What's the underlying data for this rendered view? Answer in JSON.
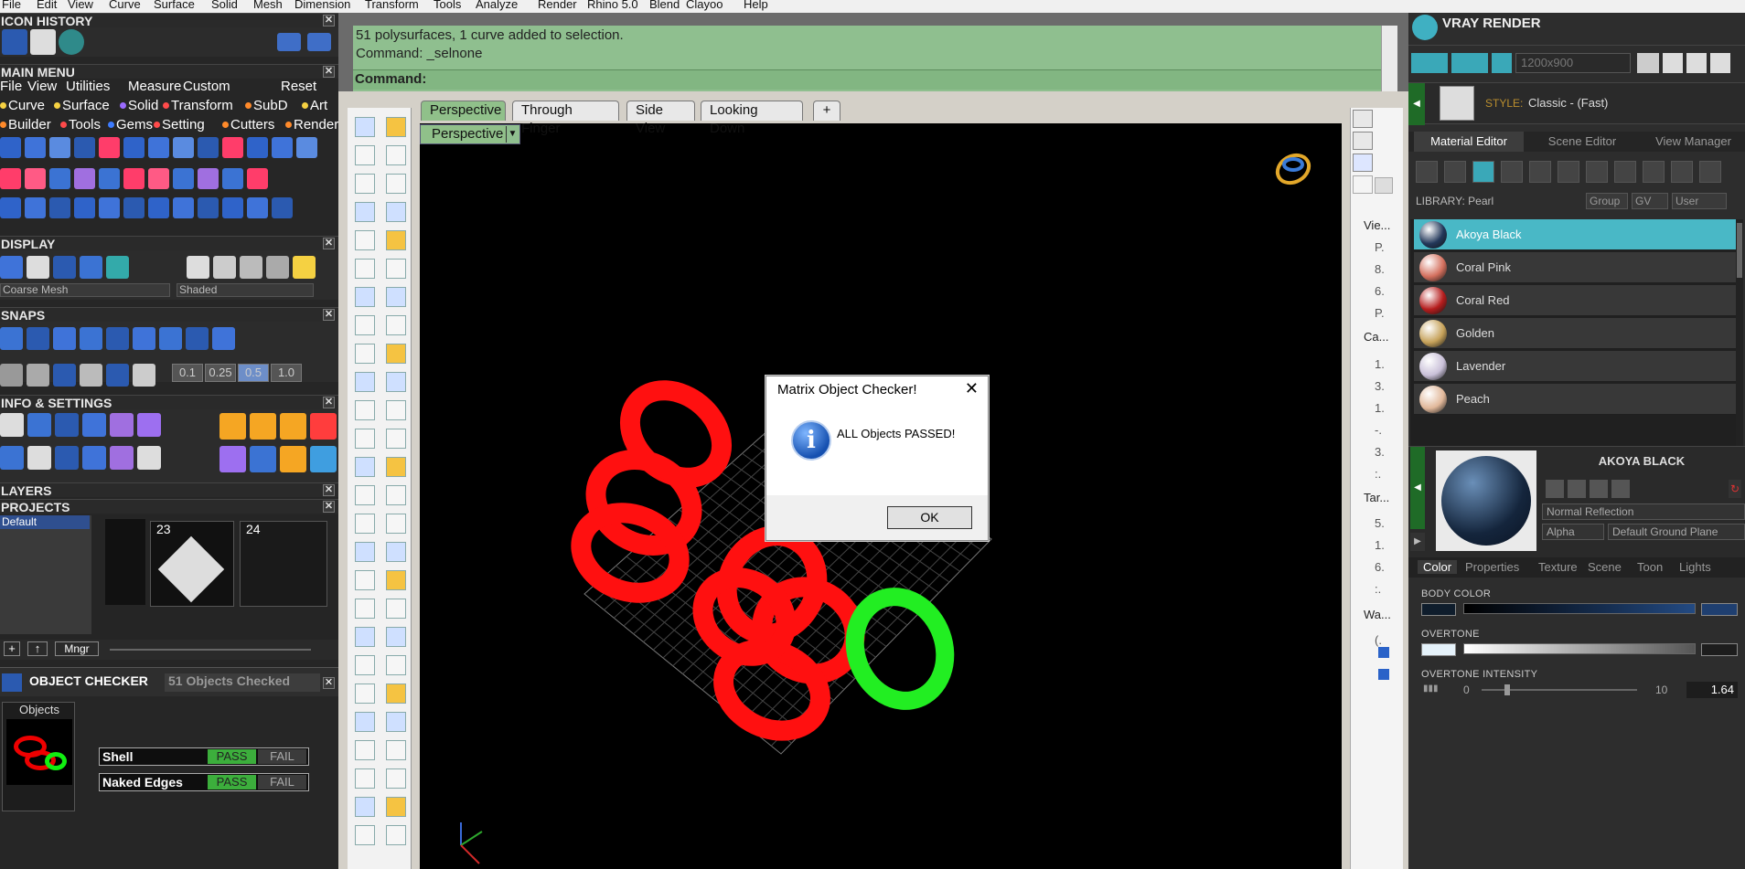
{
  "menubar": [
    "File",
    "Edit",
    "View",
    "Curve",
    "Surface",
    "Solid",
    "Mesh",
    "Dimension",
    "Transform",
    "Tools",
    "Analyze",
    "Render",
    "Rhino 5.0",
    "Blend",
    "Clayoo",
    "Help"
  ],
  "left": {
    "icon_history": "ICON HISTORY",
    "main_menu": "MAIN MENU",
    "mm_row1": [
      "File",
      "View",
      "Utilities",
      "Measure",
      "Custom"
    ],
    "mm_reset": "Reset",
    "mm_row2": [
      {
        "label": "Curve",
        "color": "#f5d142"
      },
      {
        "label": "Surface",
        "color": "#f5d142"
      },
      {
        "label": "Solid",
        "color": "#9b6bff"
      },
      {
        "label": "Transform",
        "color": "#ff4a4a"
      },
      {
        "label": "SubD",
        "color": "#ff8a2a"
      },
      {
        "label": "Art",
        "color": "#f5d142"
      }
    ],
    "mm_row3": [
      {
        "label": "Builder",
        "color": "#ff8a2a"
      },
      {
        "label": "Tools",
        "color": "#ff4a4a"
      },
      {
        "label": "Gems",
        "color": "#3d7cff"
      },
      {
        "label": "Setting",
        "color": "#ff4a4a"
      },
      {
        "label": "Cutters",
        "color": "#ff8a2a"
      },
      {
        "label": "Render",
        "color": "#ff8a2a"
      }
    ],
    "display": "DISPLAY",
    "display_mesh": "Coarse Mesh",
    "display_mode": "Shaded",
    "snaps": "SNAPS",
    "snap_values": [
      "0.1",
      "0.25",
      "0.5",
      "1.0"
    ],
    "info_settings": "INFO & SETTINGS",
    "layers": "LAYERS",
    "projects": "PROJECTS",
    "project_default": "Default",
    "project_nums": [
      "23",
      "24"
    ],
    "mngr": "Mngr",
    "object_checker": "OBJECT CHECKER",
    "checker_status": "51  Objects Checked",
    "objects_label": "Objects",
    "checks": [
      {
        "name": "Shell",
        "pass": "PASS",
        "fail": "FAIL"
      },
      {
        "name": "Naked Edges",
        "pass": "PASS",
        "fail": "FAIL"
      }
    ]
  },
  "command": {
    "line1": "51 polysurfaces, 1 curve added to selection.",
    "line2": "Command: _selnone",
    "prompt": "Command:"
  },
  "tabs": [
    "Perspective",
    "Through Finger",
    "Side View",
    "Looking Down"
  ],
  "viewport_label": "Perspective",
  "right_strip": [
    "Vie...",
    "P.",
    "8.",
    "6.",
    "P.",
    "Ca...",
    "1.",
    "3.",
    "1.",
    "-.",
    "3.",
    ":.",
    "Tar...",
    "5.",
    "1.",
    "6.",
    ":.",
    "Wa...",
    "(."
  ],
  "dialog": {
    "title": "Matrix Object Checker!",
    "message": "ALL Objects PASSED!",
    "ok": "OK"
  },
  "vray": {
    "title": "VRAY RENDER",
    "resolution": "1200x900",
    "style_label": "STYLE:",
    "style_value": "Classic - (Fast)",
    "tabs": [
      "Material Editor",
      "Scene Editor",
      "View Manager"
    ],
    "library_label": "LIBRARY: Pearl",
    "group": "Group",
    "gv": "GV",
    "user": "User",
    "materials": [
      {
        "name": "Akoya Black",
        "color": "#23385a"
      },
      {
        "name": "Coral Pink",
        "color": "#d4705e"
      },
      {
        "name": "Coral Red",
        "color": "#b51d1d"
      },
      {
        "name": "Golden",
        "color": "#c6a25a"
      },
      {
        "name": "Lavender",
        "color": "#c9c0d8"
      },
      {
        "name": "Peach",
        "color": "#e1b89a"
      }
    ],
    "preview_name": "AKOYA BLACK",
    "reflection": "Normal Reflection",
    "alpha": "Alpha",
    "ground": "Default Ground Plane",
    "bottom_tabs": [
      "Color",
      "Properties",
      "Texture",
      "Scene",
      "Toon",
      "Lights"
    ],
    "body_color": "BODY COLOR",
    "overtone": "OVERTONE",
    "overtone_intensity": "OVERTONE INTENSITY",
    "oi_min": "0",
    "oi_max": "10",
    "oi_value": "1.64"
  }
}
